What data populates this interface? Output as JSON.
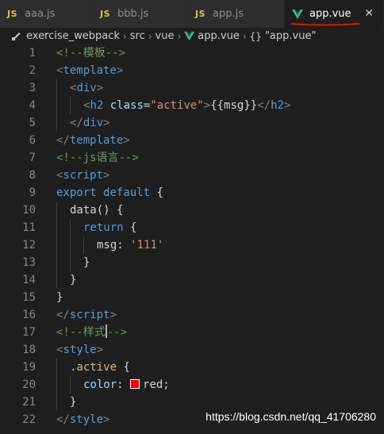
{
  "tabs": [
    {
      "icon": "JS",
      "label": "aaa.js",
      "active": false
    },
    {
      "icon": "JS",
      "label": "bbb.js",
      "active": false
    },
    {
      "icon": "JS",
      "label": "app.js",
      "active": false
    },
    {
      "icon": "V",
      "label": "app.vue",
      "active": true
    }
  ],
  "close_glyph": "✕",
  "breadcrumb": {
    "items": [
      "exercise_webpack",
      "src",
      "vue",
      "app.vue",
      "\"app.vue\""
    ],
    "braces": "{}",
    "separator": "›"
  },
  "lines": [
    {
      "num": "1",
      "indent": 0,
      "tokens": [
        {
          "c": "t-comment",
          "t": "<!--模板-->"
        }
      ]
    },
    {
      "num": "2",
      "indent": 0,
      "tokens": [
        {
          "c": "t-punct",
          "t": "<"
        },
        {
          "c": "t-tag",
          "t": "template"
        },
        {
          "c": "t-punct",
          "t": ">"
        }
      ]
    },
    {
      "num": "3",
      "indent": 1,
      "tokens": [
        {
          "c": "t-punct",
          "t": "<"
        },
        {
          "c": "t-tag",
          "t": "div"
        },
        {
          "c": "t-punct",
          "t": ">"
        }
      ]
    },
    {
      "num": "4",
      "indent": 2,
      "tokens": [
        {
          "c": "t-punct",
          "t": "<"
        },
        {
          "c": "t-tag",
          "t": "h2"
        },
        {
          "c": "t-text",
          "t": " "
        },
        {
          "c": "t-attr",
          "t": "class"
        },
        {
          "c": "t-text",
          "t": "="
        },
        {
          "c": "t-str",
          "t": "\"active\""
        },
        {
          "c": "t-punct",
          "t": ">"
        },
        {
          "c": "t-text",
          "t": "{{msg}}"
        },
        {
          "c": "t-punct",
          "t": "</"
        },
        {
          "c": "t-tag",
          "t": "h2"
        },
        {
          "c": "t-punct",
          "t": ">"
        }
      ]
    },
    {
      "num": "5",
      "indent": 1,
      "tokens": [
        {
          "c": "t-punct",
          "t": "</"
        },
        {
          "c": "t-tag",
          "t": "div"
        },
        {
          "c": "t-punct",
          "t": ">"
        }
      ]
    },
    {
      "num": "6",
      "indent": 0,
      "tokens": [
        {
          "c": "t-punct",
          "t": "</"
        },
        {
          "c": "t-tag",
          "t": "template"
        },
        {
          "c": "t-punct",
          "t": ">"
        }
      ]
    },
    {
      "num": "7",
      "indent": 0,
      "tokens": [
        {
          "c": "t-comment",
          "t": "<!--js语言-->"
        }
      ]
    },
    {
      "num": "8",
      "indent": 0,
      "tokens": [
        {
          "c": "t-punct",
          "t": "<"
        },
        {
          "c": "t-tag",
          "t": "script"
        },
        {
          "c": "t-punct",
          "t": ">"
        }
      ]
    },
    {
      "num": "9",
      "indent": 0,
      "tokens": [
        {
          "c": "t-kw",
          "t": "export"
        },
        {
          "c": "t-text",
          "t": " "
        },
        {
          "c": "t-kw",
          "t": "default"
        },
        {
          "c": "t-text",
          "t": " {"
        }
      ]
    },
    {
      "num": "10",
      "indent": 1,
      "tokens": [
        {
          "c": "t-text",
          "t": "data() {"
        }
      ]
    },
    {
      "num": "11",
      "indent": 2,
      "tokens": [
        {
          "c": "t-kw",
          "t": "return"
        },
        {
          "c": "t-text",
          "t": " {"
        }
      ]
    },
    {
      "num": "12",
      "indent": 3,
      "tokens": [
        {
          "c": "t-text",
          "t": "msg: "
        },
        {
          "c": "t-str",
          "t": "'111'"
        }
      ]
    },
    {
      "num": "13",
      "indent": 2,
      "tokens": [
        {
          "c": "t-text",
          "t": "}"
        }
      ]
    },
    {
      "num": "14",
      "indent": 1,
      "tokens": [
        {
          "c": "t-text",
          "t": "}"
        }
      ]
    },
    {
      "num": "15",
      "indent": 0,
      "tokens": [
        {
          "c": "t-text",
          "t": "}"
        }
      ]
    },
    {
      "num": "16",
      "indent": 0,
      "tokens": [
        {
          "c": "t-punct",
          "t": "</"
        },
        {
          "c": "t-tag",
          "t": "script"
        },
        {
          "c": "t-punct",
          "t": ">"
        }
      ]
    },
    {
      "num": "17",
      "indent": 0,
      "tokens": [
        {
          "c": "t-comment",
          "t": "<!--样式"
        },
        {
          "c": "cursor",
          "t": ""
        },
        {
          "c": "t-comment",
          "t": "-->"
        }
      ]
    },
    {
      "num": "18",
      "indent": 0,
      "tokens": [
        {
          "c": "t-punct",
          "t": "<"
        },
        {
          "c": "t-tag",
          "t": "style"
        },
        {
          "c": "t-punct",
          "t": ">"
        }
      ]
    },
    {
      "num": "19",
      "indent": 1,
      "tokens": [
        {
          "c": "t-sel",
          "t": ".active"
        },
        {
          "c": "t-text",
          "t": " {"
        }
      ]
    },
    {
      "num": "20",
      "indent": 2,
      "tokens": [
        {
          "c": "t-prop",
          "t": "color"
        },
        {
          "c": "t-text",
          "t": ": "
        },
        {
          "c": "swatch",
          "t": ""
        },
        {
          "c": "t-text",
          "t": "red;"
        }
      ]
    },
    {
      "num": "21",
      "indent": 1,
      "tokens": [
        {
          "c": "t-text",
          "t": "}"
        }
      ]
    },
    {
      "num": "22",
      "indent": 0,
      "tokens": [
        {
          "c": "t-punct",
          "t": "</"
        },
        {
          "c": "t-tag",
          "t": "style"
        },
        {
          "c": "t-punct",
          "t": ">"
        }
      ]
    }
  ],
  "watermark": "https://blog.csdn.net/qq_41706280",
  "colors": {
    "background": "#1e1e1e",
    "tab_inactive": "#2d2d2d",
    "js_icon": "#cbcb41",
    "vue_icon": "#41b883",
    "annotation_underline": "#e51400"
  },
  "icons": {
    "js": "js-file-icon",
    "vue": "vue-file-icon",
    "close": "close-icon",
    "folder": "folder-icon",
    "color_swatch": "red-color-swatch"
  }
}
